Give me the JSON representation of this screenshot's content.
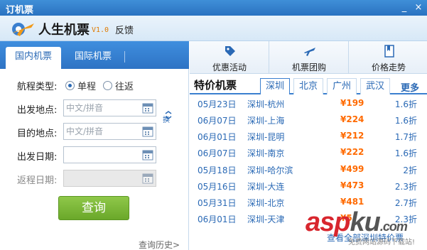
{
  "window": {
    "title": "订机票",
    "minimize_glyph": "_",
    "close_glyph": "×"
  },
  "header": {
    "app_name": "人生机票",
    "version": "V1.0",
    "feedback_label": "反馈"
  },
  "left": {
    "tabs": [
      {
        "label": "国内机票",
        "active": true
      },
      {
        "label": "国际机票",
        "active": false
      }
    ],
    "trip_type": {
      "label": "航程类型:",
      "options": [
        {
          "label": "单程",
          "checked": true
        },
        {
          "label": "往返",
          "checked": false
        }
      ]
    },
    "departure": {
      "label": "出发地点:",
      "placeholder": "中文/拼音"
    },
    "destination": {
      "label": "目的地点:",
      "placeholder": "中文/拼音"
    },
    "depart_date": {
      "label": "出发日期:",
      "value": ""
    },
    "return_date": {
      "label": "返程日期:",
      "value": ""
    },
    "swap_label": "换",
    "search_label": "查询",
    "history_label": "查询历史>"
  },
  "right": {
    "toolbar": [
      {
        "label": "优惠活动",
        "icon": "tag-icon"
      },
      {
        "label": "机票团购",
        "icon": "plane-icon"
      },
      {
        "label": "价格走势",
        "icon": "bookmark-icon"
      }
    ],
    "special_title": "特价机票",
    "city_tabs": [
      {
        "label": "深圳",
        "active": true
      },
      {
        "label": "北京",
        "active": false
      },
      {
        "label": "广州",
        "active": false
      },
      {
        "label": "武汉",
        "active": false
      }
    ],
    "more_label": "更多",
    "flights": [
      {
        "date": "05月23日",
        "route": "深圳-杭州",
        "price": "¥199",
        "discount": "1.6折"
      },
      {
        "date": "06月07日",
        "route": "深圳-上海",
        "price": "¥224",
        "discount": "1.6折"
      },
      {
        "date": "06月01日",
        "route": "深圳-昆明",
        "price": "¥212",
        "discount": "1.7折"
      },
      {
        "date": "06月07日",
        "route": "深圳-南京",
        "price": "¥222",
        "discount": "1.6折"
      },
      {
        "date": "05月18日",
        "route": "深圳-哈尔滨",
        "price": "¥499",
        "discount": "2折"
      },
      {
        "date": "05月16日",
        "route": "深圳-大连",
        "price": "¥473",
        "discount": "2.3折"
      },
      {
        "date": "05月31日",
        "route": "深圳-北京",
        "price": "¥481",
        "discount": "2.7折"
      },
      {
        "date": "06月01日",
        "route": "深圳-天津",
        "price": "¥5",
        "discount": "2.3折"
      }
    ],
    "footer_link": "查看全部深圳特价票"
  },
  "watermark": {
    "main": "asp",
    "dot": "ku",
    "tld": ".com",
    "sub": "免费网站源码下载站!"
  },
  "colors": {
    "accent": "#2a69b5",
    "price": "#ff6a00",
    "search_button": "#7ab83a"
  }
}
